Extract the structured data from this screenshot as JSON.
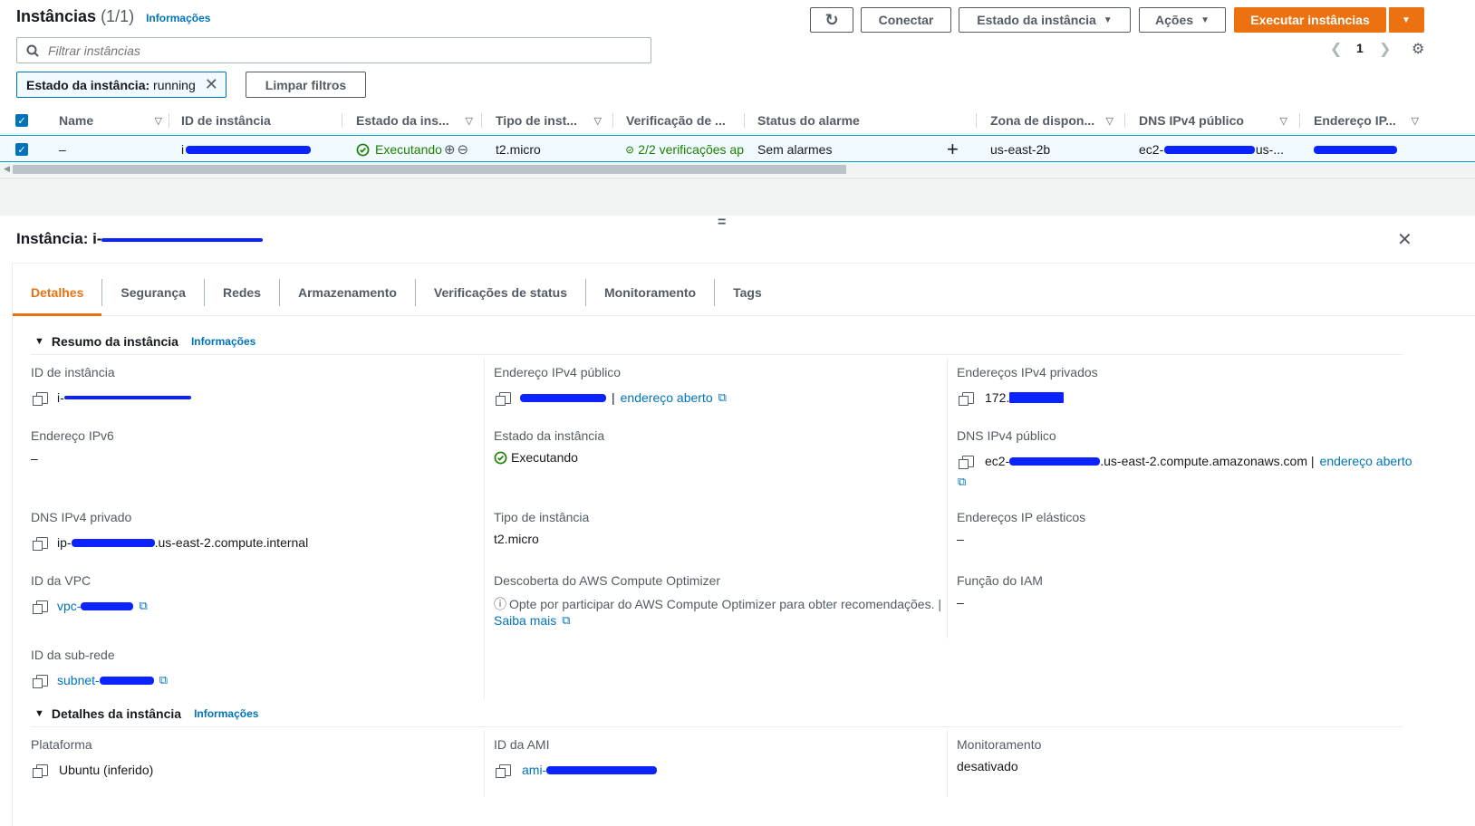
{
  "header": {
    "title": "Instâncias",
    "count": "(1/1)",
    "info": "Informações"
  },
  "toolbar": {
    "refresh": "↻",
    "connect": "Conectar",
    "instance_state": "Estado da instância",
    "actions": "Ações",
    "launch": "Executar instâncias"
  },
  "search": {
    "placeholder": "Filtrar instâncias"
  },
  "pagination": {
    "page": "1"
  },
  "filter": {
    "chip_key": "Estado da instância:",
    "chip_value": "running",
    "clear": "Limpar filtros"
  },
  "table": {
    "columns": [
      "Name",
      "ID de instância",
      "Estado da ins...",
      "Tipo de inst...",
      "Verificação de ...",
      "Status do alarme",
      "Zona de dispon...",
      "DNS IPv4 público",
      "Endereço IP..."
    ],
    "row": {
      "name": "–",
      "id_prefix": "i",
      "state": "Executando",
      "type": "t2.micro",
      "checks": "2/2 verificações ap",
      "alarm": "Sem alarmes",
      "add": "+",
      "zone": "us-east-2b",
      "dns": "ec2-",
      "dns_tail": "us-...",
      "ip": ""
    }
  },
  "panel": {
    "handle": "=",
    "title_prefix": "Instância: i-",
    "tabs": [
      "Detalhes",
      "Segurança",
      "Redes",
      "Armazenamento",
      "Verificações de status",
      "Monitoramento",
      "Tags"
    ],
    "summary": {
      "heading": "Resumo da instância",
      "info": "Informações",
      "id_label": "ID de instância",
      "id_value": "i-",
      "ipv6_label": "Endereço IPv6",
      "ipv6_value": "–",
      "private_dns_label": "DNS IPv4 privado",
      "private_dns_prefix": "ip-",
      "private_dns_suffix": ".us-east-2.compute.internal",
      "vpc_label": "ID da VPC",
      "vpc_value": "vpc-",
      "subnet_label": "ID da sub-rede",
      "subnet_value": "subnet-",
      "public_ipv4_label": "Endereço IPv4 público",
      "public_ipv4_sep": "|",
      "open_address": "endereço aberto",
      "state_label": "Estado da instância",
      "state_value": "Executando",
      "type_label": "Tipo de instância",
      "type_value": "t2.micro",
      "optimizer_label": "Descoberta do AWS Compute Optimizer",
      "optimizer_text": "Opte por participar do AWS Compute Optimizer para obter recomendações. |",
      "learn_more": "Saiba mais",
      "private_ipv4_label": "Endereços IPv4 privados",
      "private_ipv4_prefix": "172.",
      "public_dns_label": "DNS IPv4 público",
      "public_dns_prefix": "ec2-",
      "public_dns_suffix": ".us-east-2.compute.amazonaws.com |",
      "elastic_label": "Endereços IP elásticos",
      "elastic_value": "–",
      "iam_label": "Função do IAM",
      "iam_value": "–"
    },
    "details": {
      "heading": "Detalhes da instância",
      "info": "Informações",
      "platform_label": "Plataforma",
      "platform_value": "Ubuntu (inferido)",
      "ami_label": "ID da AMI",
      "ami_value": "ami-",
      "monitoring_label": "Monitoramento",
      "monitoring_value": "desativado"
    }
  },
  "colors": {
    "primary": "#ec7211",
    "link": "#0073bb",
    "success": "#1d8102",
    "redaction": "#0a23ff"
  }
}
